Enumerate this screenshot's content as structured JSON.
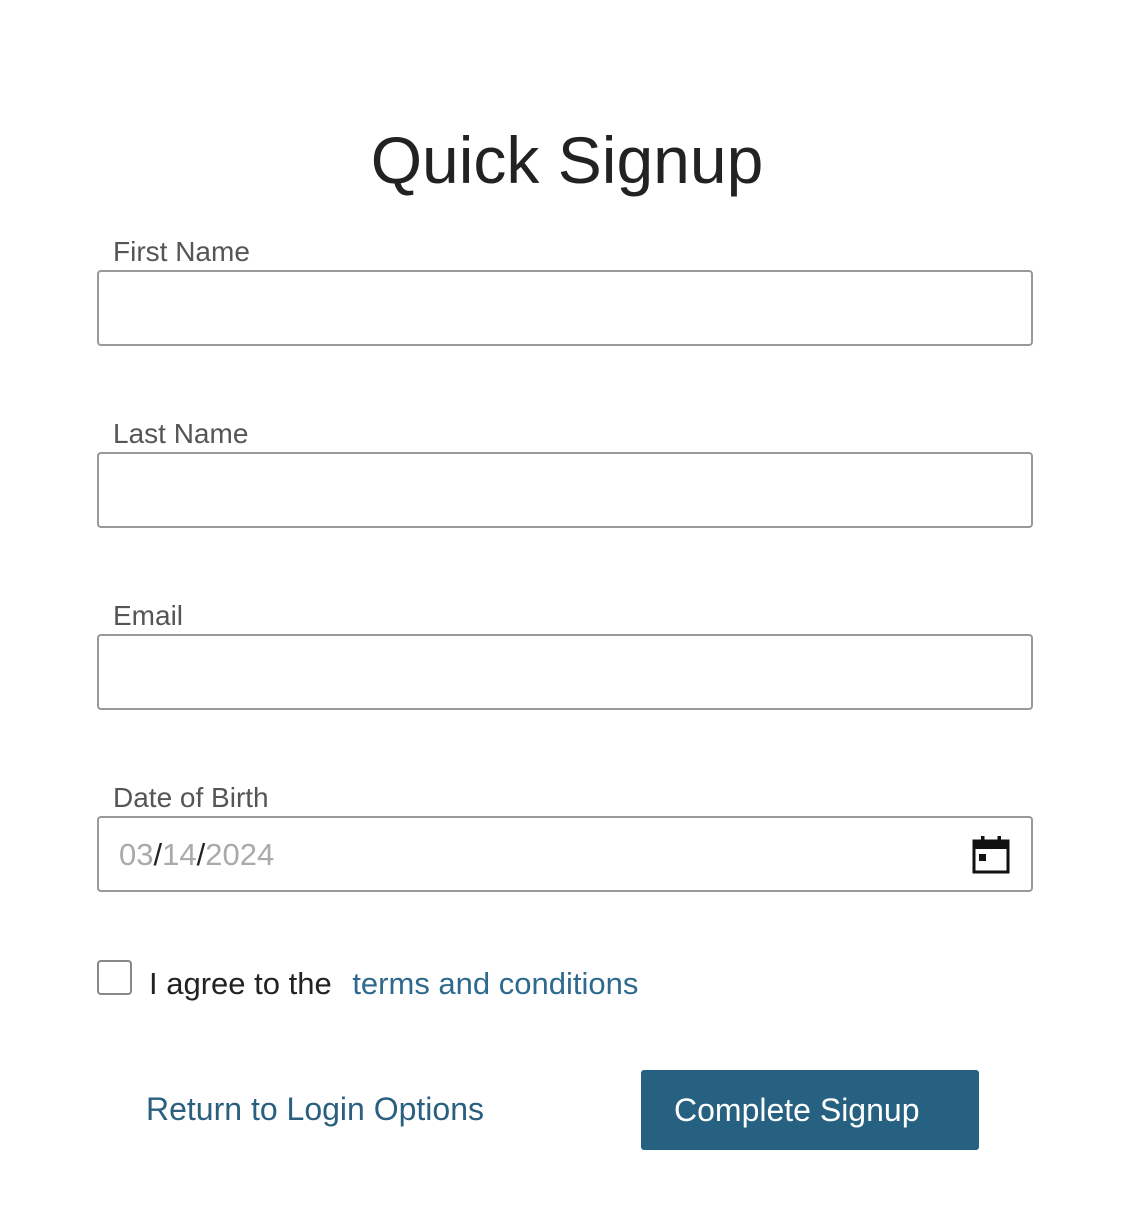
{
  "form": {
    "title": "Quick Signup",
    "fields": [
      {
        "label": "First Name",
        "value": "",
        "placeholder": ""
      },
      {
        "label": "Last Name",
        "value": "",
        "placeholder": ""
      },
      {
        "label": "Email",
        "value": "",
        "placeholder": ""
      }
    ],
    "dob": {
      "label": "Date of Birth",
      "month": "03",
      "day": "14",
      "year": "2024",
      "separator": "/",
      "icon": "calendar-icon"
    },
    "agreement": {
      "checked": false,
      "text": "I agree to the",
      "link_text": "terms and conditions"
    },
    "actions": {
      "return_label": "Return to Login Options",
      "submit_label": "Complete Signup"
    }
  },
  "colors": {
    "accent": "#276182",
    "link": "#2e6a8e",
    "border": "#999999",
    "date_placeholder": "#aaaaaa"
  }
}
